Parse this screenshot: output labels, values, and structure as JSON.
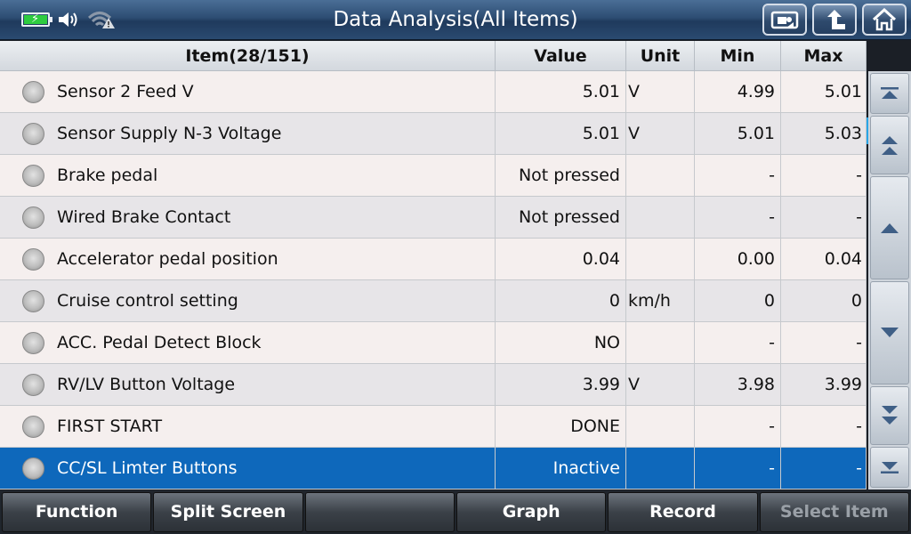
{
  "header": {
    "title": "Data Analysis(All Items)"
  },
  "table": {
    "columns": {
      "item": "Item(28/151)",
      "value": "Value",
      "unit": "Unit",
      "min": "Min",
      "max": "Max"
    },
    "rows": [
      {
        "name": "Sensor 2 Feed V",
        "value": "5.01",
        "unit": "V",
        "min": "4.99",
        "max": "5.01"
      },
      {
        "name": "Sensor Supply N-3 Voltage",
        "value": "5.01",
        "unit": "V",
        "min": "5.01",
        "max": "5.03"
      },
      {
        "name": "Brake pedal",
        "value": "Not pressed",
        "unit": "",
        "min": "-",
        "max": "-"
      },
      {
        "name": "Wired Brake Contact",
        "value": "Not pressed",
        "unit": "",
        "min": "-",
        "max": "-"
      },
      {
        "name": "Accelerator pedal position",
        "value": "0.04",
        "unit": "",
        "min": "0.00",
        "max": "0.04"
      },
      {
        "name": "Cruise control setting",
        "value": "0",
        "unit": "km/h",
        "min": "0",
        "max": "0"
      },
      {
        "name": "ACC. Pedal Detect Block",
        "value": "NO",
        "unit": "",
        "min": "-",
        "max": "-"
      },
      {
        "name": "RV/LV Button Voltage",
        "value": "3.99",
        "unit": "V",
        "min": "3.98",
        "max": "3.99"
      },
      {
        "name": "FIRST START",
        "value": "DONE",
        "unit": "",
        "min": "-",
        "max": "-"
      },
      {
        "name": "CC/SL Limter Buttons",
        "value": "Inactive",
        "unit": "",
        "min": "-",
        "max": "-"
      }
    ]
  },
  "bottom_bar": {
    "function": "Function",
    "split_screen": "Split Screen",
    "empty": "",
    "graph": "Graph",
    "record": "Record",
    "select_item": "Select Item"
  },
  "colors": {
    "title_bar": "#2d4d73",
    "selected_row": "#0e68bb",
    "battery": "#2ecc40"
  },
  "icons": [
    "battery-icon",
    "volume-icon",
    "wifi-warning-icon",
    "screenshot-icon",
    "back-icon",
    "home-icon"
  ]
}
